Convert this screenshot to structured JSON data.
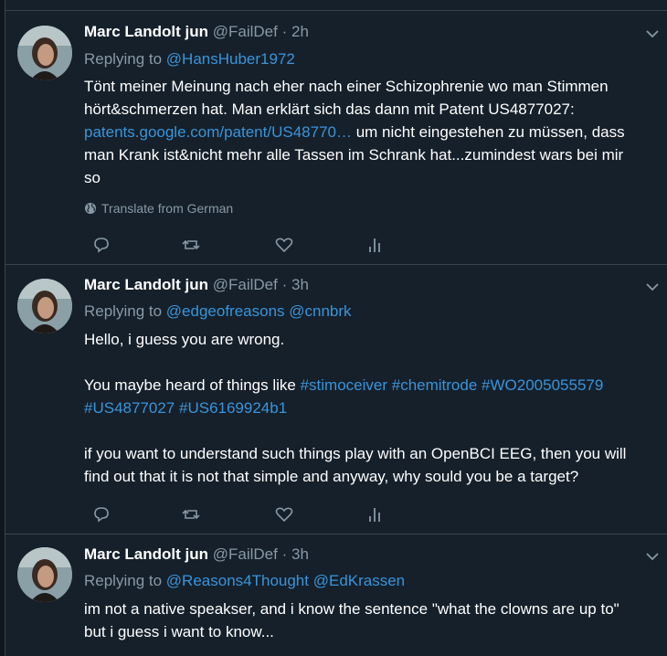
{
  "tweets": [
    {
      "name": "Marc Landolt jun",
      "handle": "@FailDef",
      "dot": "·",
      "time": "2h",
      "replying_prefix": "Replying to",
      "mentions": [
        "@HansHuber1972"
      ],
      "lines": [
        "Tönt meiner Meinung nach eher nach einer Schizophrenie wo man Stimmen",
        "hört&schmerzen hat. Man erklärt sich das dann mit Patent US4877027:"
      ],
      "link_text": "patents.google.com/patent/US48770…",
      "after_link": " um nicht eingestehen zu müssen, dass",
      "lines_after": [
        "man Krank ist&nicht mehr alle Tassen im Schrank hat...zumindest wars bei mir",
        "so"
      ],
      "translate": "Translate from German"
    },
    {
      "name": "Marc Landolt jun",
      "handle": "@FailDef",
      "dot": "·",
      "time": "3h",
      "replying_prefix": "Replying to",
      "mentions": [
        "@edgeofreasons",
        "@cnnbrk"
      ],
      "line1": "Hello, i guess you are wrong.",
      "line2_prefix": "You maybe heard of things like ",
      "hashtags_row1": [
        "#stimoceiver",
        "#chemitrode",
        "#WO2005055579"
      ],
      "hashtags_row2": [
        "#US4877027",
        "#US6169924b1"
      ],
      "line3": "if you want to understand such things play with an OpenBCI EEG, then you will",
      "line4": "find out that it is not that simple and anyway, why sould you be a target?"
    },
    {
      "name": "Marc Landolt jun",
      "handle": "@FailDef",
      "dot": "·",
      "time": "3h",
      "replying_prefix": "Replying to",
      "mentions": [
        "@Reasons4Thought",
        "@EdKrassen"
      ],
      "line1": "im not a native speakser, and i know the sentence \"what the clowns are up to\"",
      "line2": "but i guess i want to know..."
    }
  ],
  "colors": {
    "background": "#15202b",
    "border": "#38444d",
    "muted": "#8899a6",
    "link": "#3b94d9"
  },
  "icons": [
    "reply-icon",
    "retweet-icon",
    "like-icon",
    "analytics-icon",
    "chevron-down-icon",
    "globe-icon"
  ]
}
